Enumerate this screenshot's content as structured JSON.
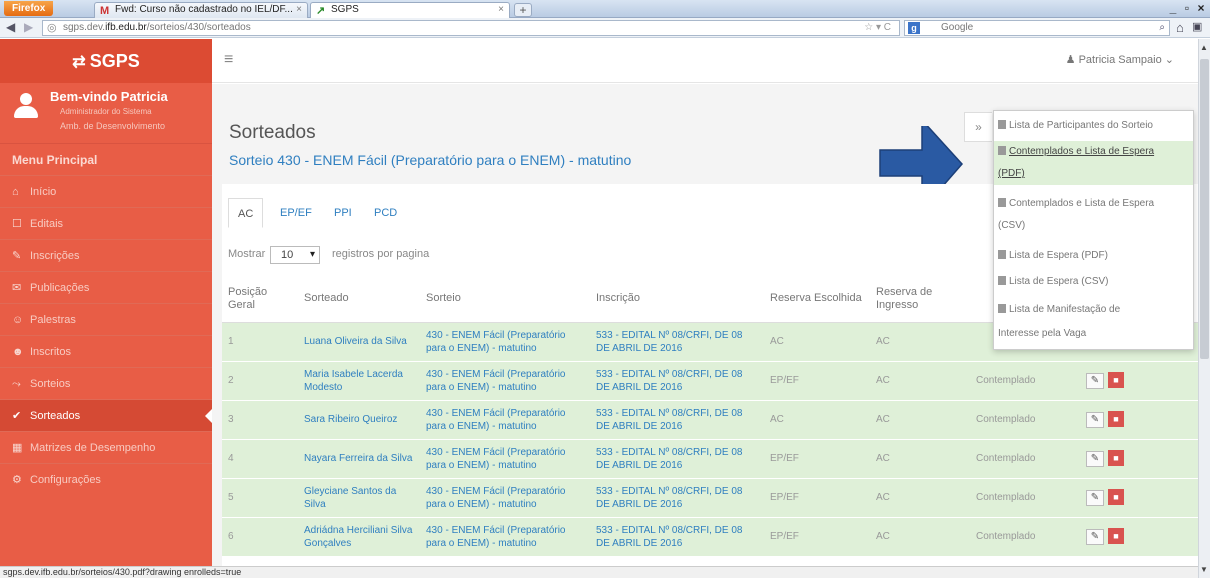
{
  "browser": {
    "app_button": "Firefox",
    "tabs": [
      {
        "icon": "M",
        "title": "Fwd: Curso não cadastrado no IEL/DF..."
      },
      {
        "icon": "↗",
        "title": "SGPS"
      }
    ],
    "url_prefix": "sgps.dev.",
    "url_domain": "ifb.edu.br",
    "url_path": "/sorteios/430/sorteados",
    "search_engine": "Google",
    "status_text": "sgps.dev.ifb.edu.br/sorteios/430.pdf?drawing enrolleds=true"
  },
  "sidebar": {
    "logo": "SGPS",
    "welcome": "Bem-vindo Patricia",
    "role": "Administrador do Sistema",
    "environment": "Amb. de Desenvolvimento",
    "menu_title": "Menu Principal",
    "items": [
      {
        "icon": "⌂",
        "label": "Início"
      },
      {
        "icon": "☐",
        "label": "Editais"
      },
      {
        "icon": "✎",
        "label": "Inscrições"
      },
      {
        "icon": "✉",
        "label": "Publicações"
      },
      {
        "icon": "☺",
        "label": "Palestras"
      },
      {
        "icon": "☻",
        "label": "Inscritos"
      },
      {
        "icon": "⤳",
        "label": "Sorteios"
      },
      {
        "icon": "✔",
        "label": "Sorteados"
      },
      {
        "icon": "▦",
        "label": "Matrizes de Desempenho"
      },
      {
        "icon": "⚙",
        "label": "Configurações"
      }
    ]
  },
  "header": {
    "user": "Patricia Sampaio"
  },
  "main": {
    "title": "Sorteados",
    "subtitle": "Sorteio 430 - ENEM Fácil (Preparatório para o ENEM) - matutino",
    "tabs": [
      "AC",
      "EP/EF",
      "PPI",
      "PCD"
    ],
    "show_label": "Mostrar",
    "page_size": "10",
    "per_page_label": "registros por pagina",
    "columns": [
      "Posição Geral",
      "Sorteado",
      "Sorteio",
      "Inscrição",
      "Reserva Escolhida",
      "Reserva de Ingresso",
      "",
      ""
    ],
    "rows": [
      {
        "pos": "1",
        "name": "Luana Oliveira da Silva",
        "sorteio": "430 - ENEM Fácil (Preparatório para o ENEM) - matutino",
        "inscricao": "533 - EDITAL Nº 08/CRFI, DE 08 DE ABRIL DE 2016",
        "reserva": "AC",
        "ingresso": "AC",
        "status": ""
      },
      {
        "pos": "2",
        "name": "Maria Isabele Lacerda Modesto",
        "sorteio": "430 - ENEM Fácil (Preparatório para o ENEM) - matutino",
        "inscricao": "533 - EDITAL Nº 08/CRFI, DE 08 DE ABRIL DE 2016",
        "reserva": "EP/EF",
        "ingresso": "AC",
        "status": "Contemplado"
      },
      {
        "pos": "3",
        "name": "Sara Ribeiro Queiroz",
        "sorteio": "430 - ENEM Fácil (Preparatório para o ENEM) - matutino",
        "inscricao": "533 - EDITAL Nº 08/CRFI, DE 08 DE ABRIL DE 2016",
        "reserva": "AC",
        "ingresso": "AC",
        "status": "Contemplado"
      },
      {
        "pos": "4",
        "name": "Nayara Ferreira da Silva",
        "sorteio": "430 - ENEM Fácil (Preparatório para o ENEM) - matutino",
        "inscricao": "533 - EDITAL Nº 08/CRFI, DE 08 DE ABRIL DE 2016",
        "reserva": "EP/EF",
        "ingresso": "AC",
        "status": "Contemplado"
      },
      {
        "pos": "5",
        "name": "Gleyciane Santos da Silva",
        "sorteio": "430 - ENEM Fácil (Preparatório para o ENEM) - matutino",
        "inscricao": "533 - EDITAL Nº 08/CRFI, DE 08 DE ABRIL DE 2016",
        "reserva": "EP/EF",
        "ingresso": "AC",
        "status": "Contemplado"
      },
      {
        "pos": "6",
        "name": "Adriádna Herciliani Silva Gonçalves",
        "sorteio": "430 - ENEM Fácil (Preparatório para o ENEM) - matutino",
        "inscricao": "533 - EDITAL Nº 08/CRFI, DE 08 DE ABRIL DE 2016",
        "reserva": "EP/EF",
        "ingresso": "AC",
        "status": "Contemplado"
      }
    ]
  },
  "dropdown": {
    "items": [
      "Lista de Participantes do Sorteio",
      "Contemplados e Lista de Espera",
      "(PDF)",
      "Contemplados e Lista de Espera",
      "(CSV)",
      "Lista de Espera (PDF)",
      "Lista de Espera (CSV)",
      "Lista de Manifestação de",
      "Interesse pela Vaga"
    ]
  },
  "colors": {
    "sidebar": "#e85d46",
    "accent": "#2f7fc0",
    "row_highlight": "#dff0d8",
    "arrow": "#2a5aa3"
  }
}
